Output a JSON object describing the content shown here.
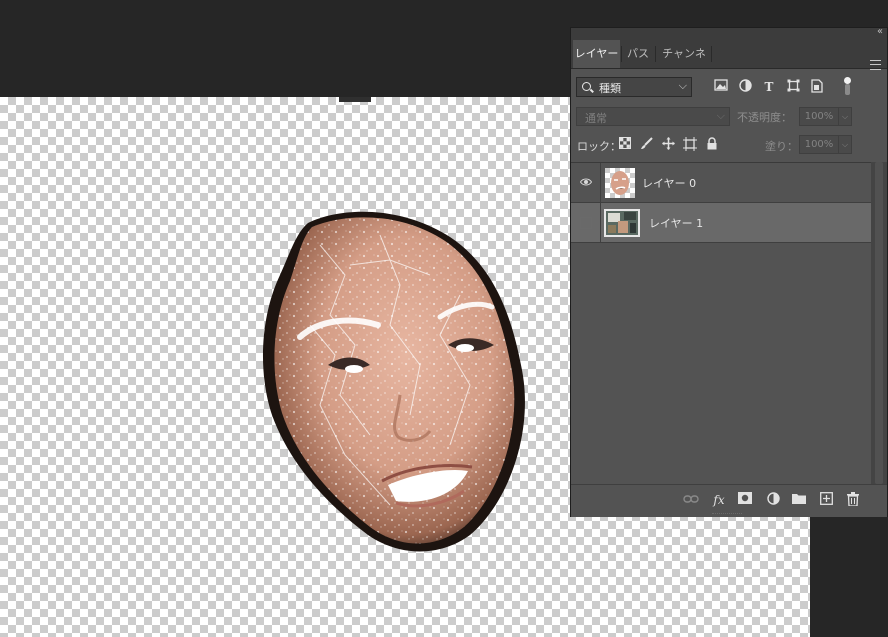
{
  "layers_panel": {
    "tabs": [
      {
        "label": "レイヤー",
        "active": true
      },
      {
        "label": "パス",
        "active": false
      },
      {
        "label": "チャンネル",
        "active": false
      }
    ],
    "filter": {
      "kind_label": "種類",
      "icons": [
        "image-filter-icon",
        "adjustment-filter-icon",
        "type-filter-icon",
        "shape-filter-icon",
        "smart-object-filter-icon",
        "filter-toggle"
      ]
    },
    "blend_mode": "通常",
    "opacity_label": "不透明度：",
    "opacity_value": "100%",
    "lock_label": "ロック：",
    "lock_icons": [
      "lock-transparent-pixels-icon",
      "lock-image-pixels-icon",
      "lock-position-icon",
      "lock-artboard-icon",
      "lock-all-icon"
    ],
    "fill_label": "塗り：",
    "fill_value": "100%",
    "layers": [
      {
        "name": "レイヤー 0",
        "visible": true,
        "selected": false
      },
      {
        "name": "レイヤー 1",
        "visible": false,
        "selected": true
      }
    ],
    "bottom_icons": [
      "link-layers-icon",
      "fx-icon",
      "layer-mask-icon",
      "adjustment-layer-icon",
      "group-folder-icon",
      "new-layer-icon",
      "trash-icon"
    ],
    "bottom_fx_text": "fx"
  },
  "colors": {
    "app_background": "#262626",
    "panel_background": "#535353",
    "selected_layer": "#696969"
  }
}
